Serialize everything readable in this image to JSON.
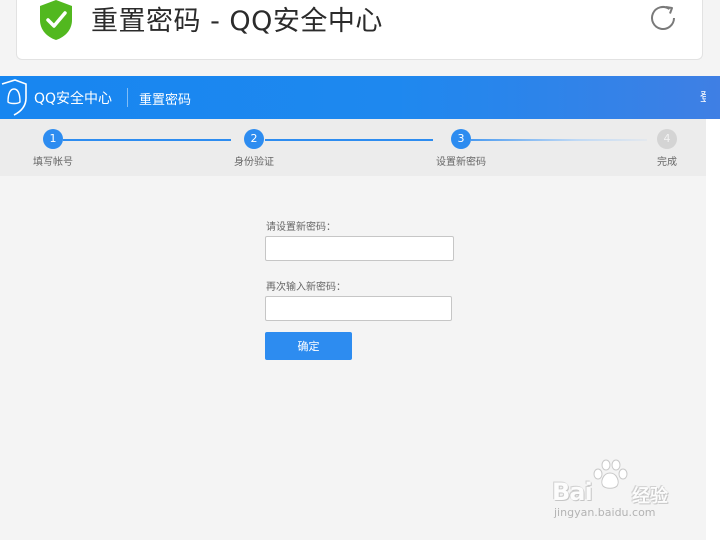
{
  "browser": {
    "title": "重置密码 - QQ安全中心",
    "icons": {
      "security": "shield-check-icon",
      "reload": "reload-icon"
    },
    "colors": {
      "shield": "#52b81f"
    }
  },
  "header": {
    "site_name": "QQ安全中心",
    "page_name": "重置密码",
    "right_link": "登",
    "colors": {
      "bar_start": "#1786f0",
      "bar_end": "#3f7fe4"
    }
  },
  "steps": {
    "active_step": 3,
    "items": [
      {
        "number": "1",
        "label": "填写帐号",
        "status": "done"
      },
      {
        "number": "2",
        "label": "身份验证",
        "status": "done"
      },
      {
        "number": "3",
        "label": "设置新密码",
        "status": "current"
      },
      {
        "number": "4",
        "label": "完成",
        "status": "todo"
      }
    ],
    "colors": {
      "active": "#2d8cf0",
      "inactive": "#d4d4d4"
    }
  },
  "form": {
    "new_password_label": "请设置新密码：",
    "new_password_value": "",
    "confirm_password_label": "再次输入新密码：",
    "confirm_password_value": "",
    "submit_label": "确定"
  },
  "watermark": {
    "brand": "Bai",
    "brand_suffix": "经验",
    "url": "jingyan.baidu.com"
  }
}
